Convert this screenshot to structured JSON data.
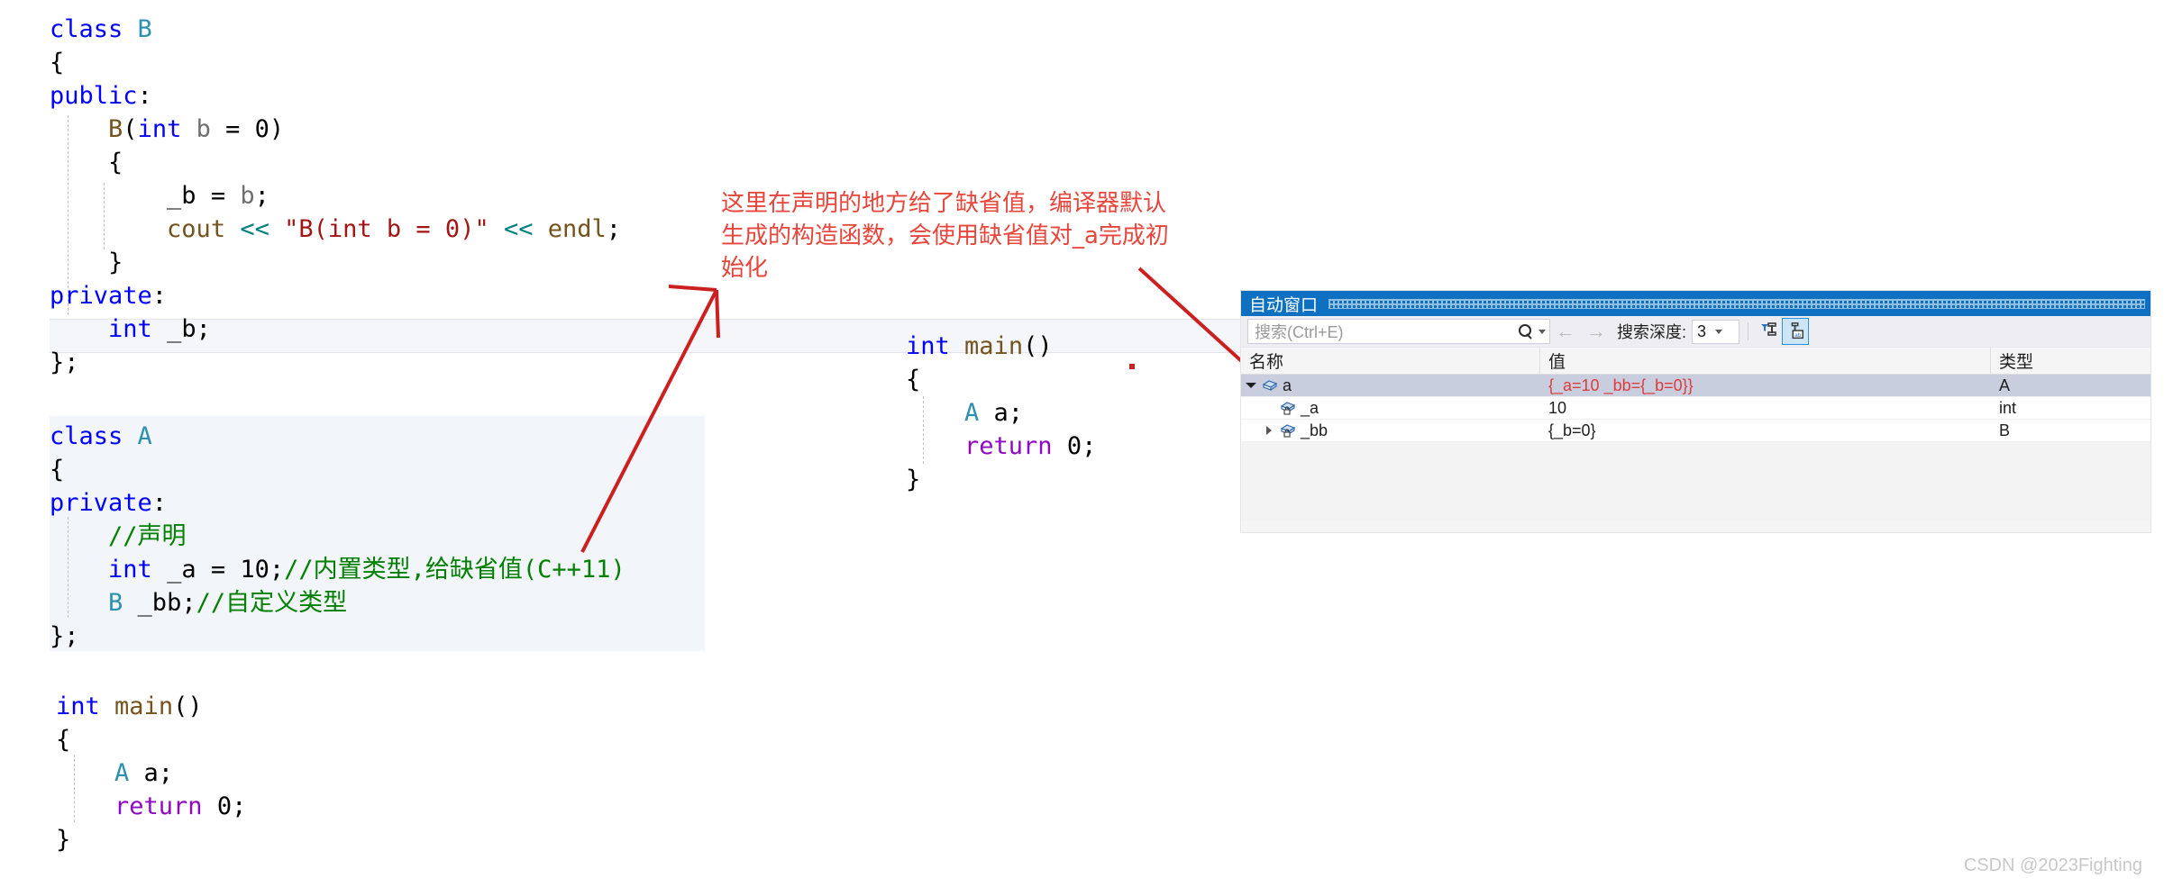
{
  "code_block_b": {
    "lines": [
      [
        {
          "t": "class ",
          "c": "kw"
        },
        {
          "t": "B",
          "c": "type"
        }
      ],
      [
        {
          "t": "{",
          "c": "pln"
        }
      ],
      [
        {
          "t": "public",
          "c": "kw"
        },
        {
          "t": ":",
          "c": "pln"
        }
      ],
      [
        {
          "t": "    ",
          "c": "pln"
        },
        {
          "t": "B",
          "c": "fn"
        },
        {
          "t": "(",
          "c": "pln"
        },
        {
          "t": "int",
          "c": "kw"
        },
        {
          "t": " ",
          "c": "pln"
        },
        {
          "t": "b",
          "c": "var"
        },
        {
          "t": " = ",
          "c": "pln"
        },
        {
          "t": "0",
          "c": "num"
        },
        {
          "t": ")",
          "c": "pln"
        }
      ],
      [
        {
          "t": "    {",
          "c": "pln"
        }
      ],
      [
        {
          "t": "        ",
          "c": "pln"
        },
        {
          "t": "_b",
          "c": "pln"
        },
        {
          "t": " = ",
          "c": "pln"
        },
        {
          "t": "b",
          "c": "var"
        },
        {
          "t": ";",
          "c": "pln"
        }
      ],
      [
        {
          "t": "        ",
          "c": "pln"
        },
        {
          "t": "cout",
          "c": "fn"
        },
        {
          "t": " ",
          "c": "pln"
        },
        {
          "t": "<<",
          "c": "op"
        },
        {
          "t": " ",
          "c": "pln"
        },
        {
          "t": "\"B(int b = 0)\"",
          "c": "str"
        },
        {
          "t": " ",
          "c": "pln"
        },
        {
          "t": "<<",
          "c": "op"
        },
        {
          "t": " ",
          "c": "pln"
        },
        {
          "t": "endl",
          "c": "fn"
        },
        {
          "t": ";",
          "c": "pln"
        }
      ],
      [
        {
          "t": "    }",
          "c": "pln"
        }
      ],
      [
        {
          "t": "private",
          "c": "kw"
        },
        {
          "t": ":",
          "c": "pln"
        }
      ],
      [
        {
          "t": "    ",
          "c": "pln"
        },
        {
          "t": "int",
          "c": "kw"
        },
        {
          "t": " _b;",
          "c": "pln"
        }
      ],
      [
        {
          "t": "};",
          "c": "pln"
        }
      ]
    ]
  },
  "code_block_a": {
    "lines": [
      [
        {
          "t": "class ",
          "c": "kw"
        },
        {
          "t": "A",
          "c": "type"
        }
      ],
      [
        {
          "t": "{",
          "c": "pln"
        }
      ],
      [
        {
          "t": "private",
          "c": "kw"
        },
        {
          "t": ":",
          "c": "pln"
        }
      ],
      [
        {
          "t": "    ",
          "c": "pln"
        },
        {
          "t": "//声明",
          "c": "cmt"
        }
      ],
      [
        {
          "t": "    ",
          "c": "pln"
        },
        {
          "t": "int",
          "c": "kw"
        },
        {
          "t": " _a = ",
          "c": "pln"
        },
        {
          "t": "10",
          "c": "num"
        },
        {
          "t": ";",
          "c": "pln"
        },
        {
          "t": "//内置类型,给缺省值(C++11)",
          "c": "cmt"
        }
      ],
      [
        {
          "t": "    ",
          "c": "pln"
        },
        {
          "t": "B",
          "c": "type"
        },
        {
          "t": " _bb;",
          "c": "pln"
        },
        {
          "t": "//自定义类型",
          "c": "cmt"
        }
      ],
      [
        {
          "t": "};",
          "c": "pln"
        }
      ]
    ]
  },
  "code_block_main_middle": {
    "lines": [
      [
        {
          "t": "int",
          "c": "kw"
        },
        {
          "t": " ",
          "c": "pln"
        },
        {
          "t": "main",
          "c": "fn"
        },
        {
          "t": "()",
          "c": "pln"
        }
      ],
      [
        {
          "t": "{",
          "c": "pln"
        }
      ],
      [
        {
          "t": "    ",
          "c": "pln"
        },
        {
          "t": "A",
          "c": "type"
        },
        {
          "t": " a;",
          "c": "pln"
        }
      ],
      [
        {
          "t": "    ",
          "c": "pln"
        },
        {
          "t": "return",
          "c": "ctl"
        },
        {
          "t": " ",
          "c": "pln"
        },
        {
          "t": "0",
          "c": "num"
        },
        {
          "t": ";",
          "c": "pln"
        }
      ],
      [
        {
          "t": "}",
          "c": "pln"
        }
      ]
    ]
  },
  "code_block_main_bottom": {
    "lines": [
      [
        {
          "t": "int",
          "c": "kw"
        },
        {
          "t": " ",
          "c": "pln"
        },
        {
          "t": "main",
          "c": "fn"
        },
        {
          "t": "()",
          "c": "pln"
        }
      ],
      [
        {
          "t": "{",
          "c": "pln"
        }
      ],
      [
        {
          "t": "    ",
          "c": "pln"
        },
        {
          "t": "A",
          "c": "type"
        },
        {
          "t": " a;",
          "c": "pln"
        }
      ],
      [
        {
          "t": "    ",
          "c": "pln"
        },
        {
          "t": "return",
          "c": "ctl"
        },
        {
          "t": " ",
          "c": "pln"
        },
        {
          "t": "0",
          "c": "num"
        },
        {
          "t": ";",
          "c": "pln"
        }
      ],
      [
        {
          "t": "}",
          "c": "pln"
        }
      ]
    ]
  },
  "annotation": {
    "color": "#e8453c",
    "line1": "这里在声明的地方给了缺省值，编译器默认",
    "line2": "生成的构造函数，会使用缺省值对_a完成初",
    "line3": "始化"
  },
  "autos_window": {
    "title": "自动窗口",
    "toolbar": {
      "search_placeholder": "搜索(Ctrl+E)",
      "search_value": "",
      "back_arrow": "←",
      "forward_arrow": "→",
      "depth_label": "搜索深度:",
      "depth_value": "3"
    },
    "columns": [
      "名称",
      "值",
      "类型"
    ],
    "rows": [
      {
        "name": "a",
        "value": "{_a=10 _bb={_b=0}}",
        "type": "A",
        "indent": 0,
        "expander": "down",
        "selected": true,
        "changed": true
      },
      {
        "name": "_a",
        "value": "10",
        "type": "int",
        "indent": 1,
        "expander": "none",
        "selected": false,
        "changed": false
      },
      {
        "name": "_bb",
        "value": "{_b=0}",
        "type": "B",
        "indent": 1,
        "expander": "right",
        "selected": false,
        "changed": false
      }
    ]
  },
  "watermark": {
    "text": "CSDN @2023Fighting"
  }
}
